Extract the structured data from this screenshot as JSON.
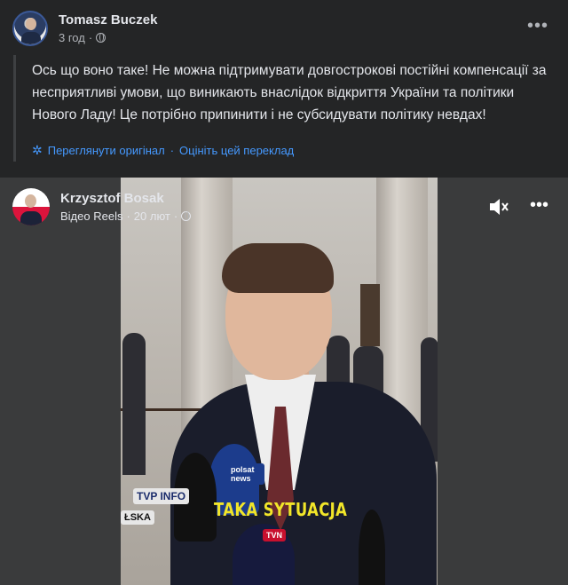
{
  "post": {
    "author": "Tomasz Buczek",
    "time": "3 год",
    "separator": "·",
    "text": "Ось що воно таке! Не можна підтримувати довгострокові постійні компенсації за несприятливі умови, що виникають внаслідок відкриття України та політики Нового Ладу! Це потрібно припинити і не субсидувати політику невдах!",
    "translation": {
      "see_original": "Переглянути оригінал",
      "dot": "·",
      "rate": "Оцініть цей переклад"
    },
    "more": "•••"
  },
  "shared": {
    "author": "Krzysztof Bosak",
    "type": "Відео Reels",
    "separator": "·",
    "date": "20 лют",
    "separator2": "·",
    "more": "•••",
    "caption": "TAKA SYTUACJA",
    "mic_labels": [
      "polsat news",
      "TVP INFO",
      "ŁSKA",
      "TVN"
    ]
  },
  "icons": {
    "privacy": "globe-icon",
    "settings": "gear-icon",
    "volume": "speaker-muted-icon"
  }
}
